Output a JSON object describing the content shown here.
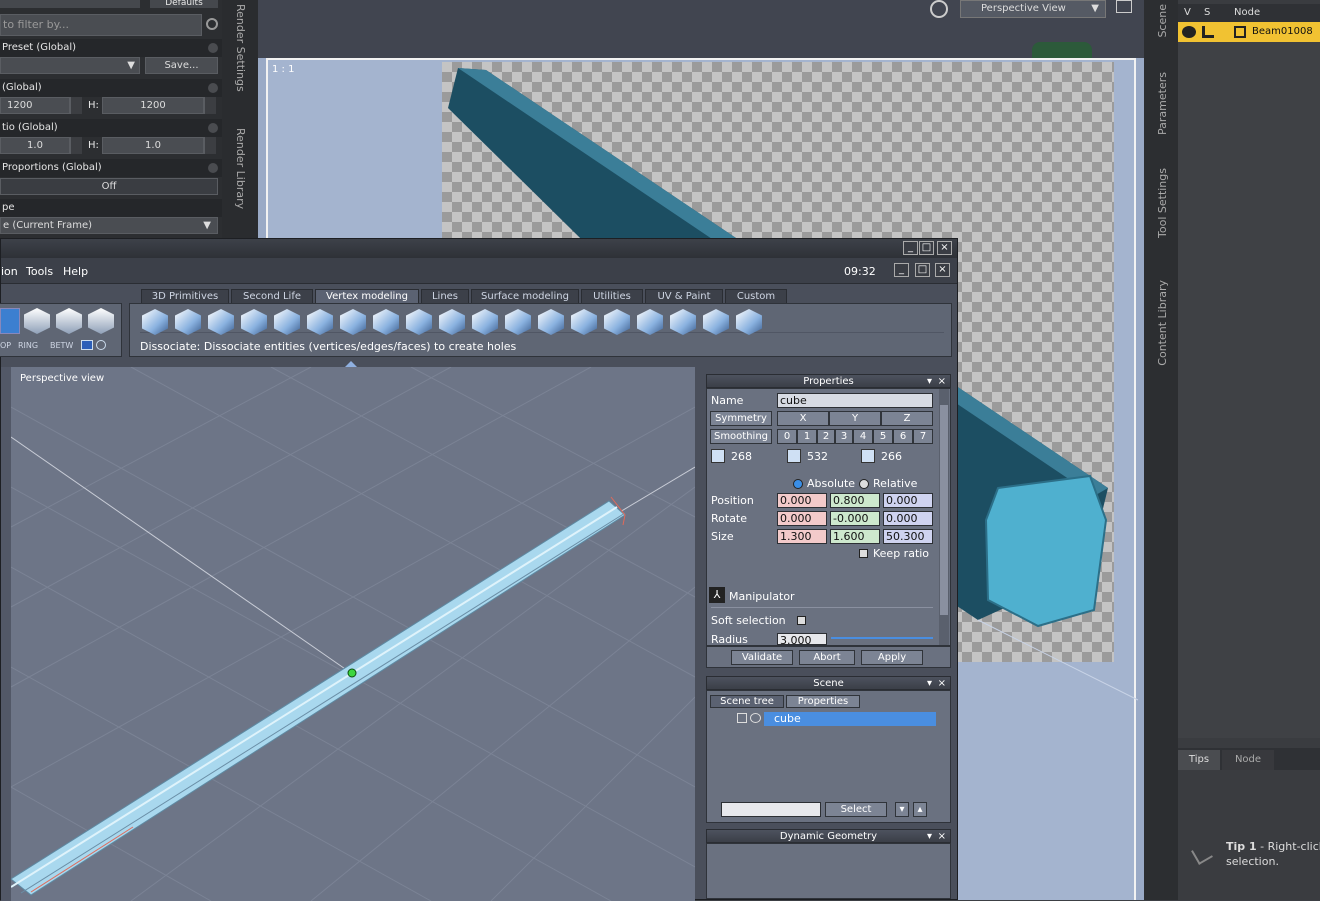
{
  "render_settings": {
    "filter_placeholder": "to filter by...",
    "defaults_label": "Defaults",
    "preset_label": "Preset (Global)",
    "save_label": "Save...",
    "size_label": "(Global)",
    "width_value": "1200",
    "height_label": "H:",
    "height_value": "1200",
    "ratio_label": "tio (Global)",
    "ratio_w": "1.0",
    "ratio_h": "1.0",
    "proportions_label": "Proportions (Global)",
    "proportions_value": "Off",
    "type_label": "pe",
    "type_value": "e (Current Frame)",
    "side_tab_render_settings": "Render Settings",
    "side_tab_render_library": "Render Library"
  },
  "viewport": {
    "view_name": "Perspective View",
    "ratio_label": "1 : 1"
  },
  "scene_panel": {
    "col_v": "V",
    "col_s": "S",
    "col_node": "Node",
    "node_name": "Beam01008",
    "side_tabs": [
      "Scene",
      "Parameters",
      "Tool Settings",
      "Content Library"
    ],
    "bottom_tabs": [
      "Tips",
      "Node"
    ],
    "tip_title": "Tip 1",
    "tip_text": " - Right-click",
    "tip_text2": "selection."
  },
  "hexagon": {
    "menu": [
      "ion",
      "Tools",
      "Help"
    ],
    "clock": "09:32",
    "tabs": [
      "3D Primitives",
      "Second Life",
      "Vertex modeling",
      "Lines",
      "Surface modeling",
      "Utilities",
      "UV & Paint",
      "Custom"
    ],
    "active_tab": "Vertex modeling",
    "left_tool_labels": [
      "OP",
      "RING",
      "BETW"
    ],
    "status": "Dissociate: Dissociate entities (vertices/edges/faces) to create holes",
    "viewport_label": "Perspective view"
  },
  "properties": {
    "title": "Properties",
    "name_label": "Name",
    "name_value": "cube",
    "symmetry_label": "Symmetry",
    "axes": [
      "X",
      "Y",
      "Z"
    ],
    "smoothing_label": "Smoothing",
    "smoothing_levels": [
      "0",
      "1",
      "2",
      "3",
      "4",
      "5",
      "6",
      "7"
    ],
    "counts": [
      "268",
      "532",
      "266"
    ],
    "absolute_label": "Absolute",
    "relative_label": "Relative",
    "position_label": "Position",
    "position": [
      "0.000",
      "0.800",
      "0.000"
    ],
    "rotate_label": "Rotate",
    "rotate": [
      "0.000",
      "-0.000",
      "0.000"
    ],
    "size_label": "Size",
    "size": [
      "1.300",
      "1.600",
      "50.300"
    ],
    "keep_ratio_label": "Keep ratio",
    "manipulator_label": "Manipulator",
    "soft_selection_label": "Soft selection",
    "radius_label": "Radius",
    "radius_value": "3.000",
    "validate_label": "Validate",
    "abort_label": "Abort",
    "apply_label": "Apply"
  },
  "scene": {
    "title": "Scene",
    "tab_tree": "Scene tree",
    "tab_props": "Properties",
    "item": "cube",
    "select_label": "Select"
  },
  "dynamic_geometry": {
    "title": "Dynamic Geometry"
  },
  "colors": {
    "pos_x": "#f3caca",
    "pos_y": "#cde8cd",
    "pos_z": "#cfd3f0",
    "selection": "#4a8ee0",
    "node_highlight": "#f1c232"
  }
}
